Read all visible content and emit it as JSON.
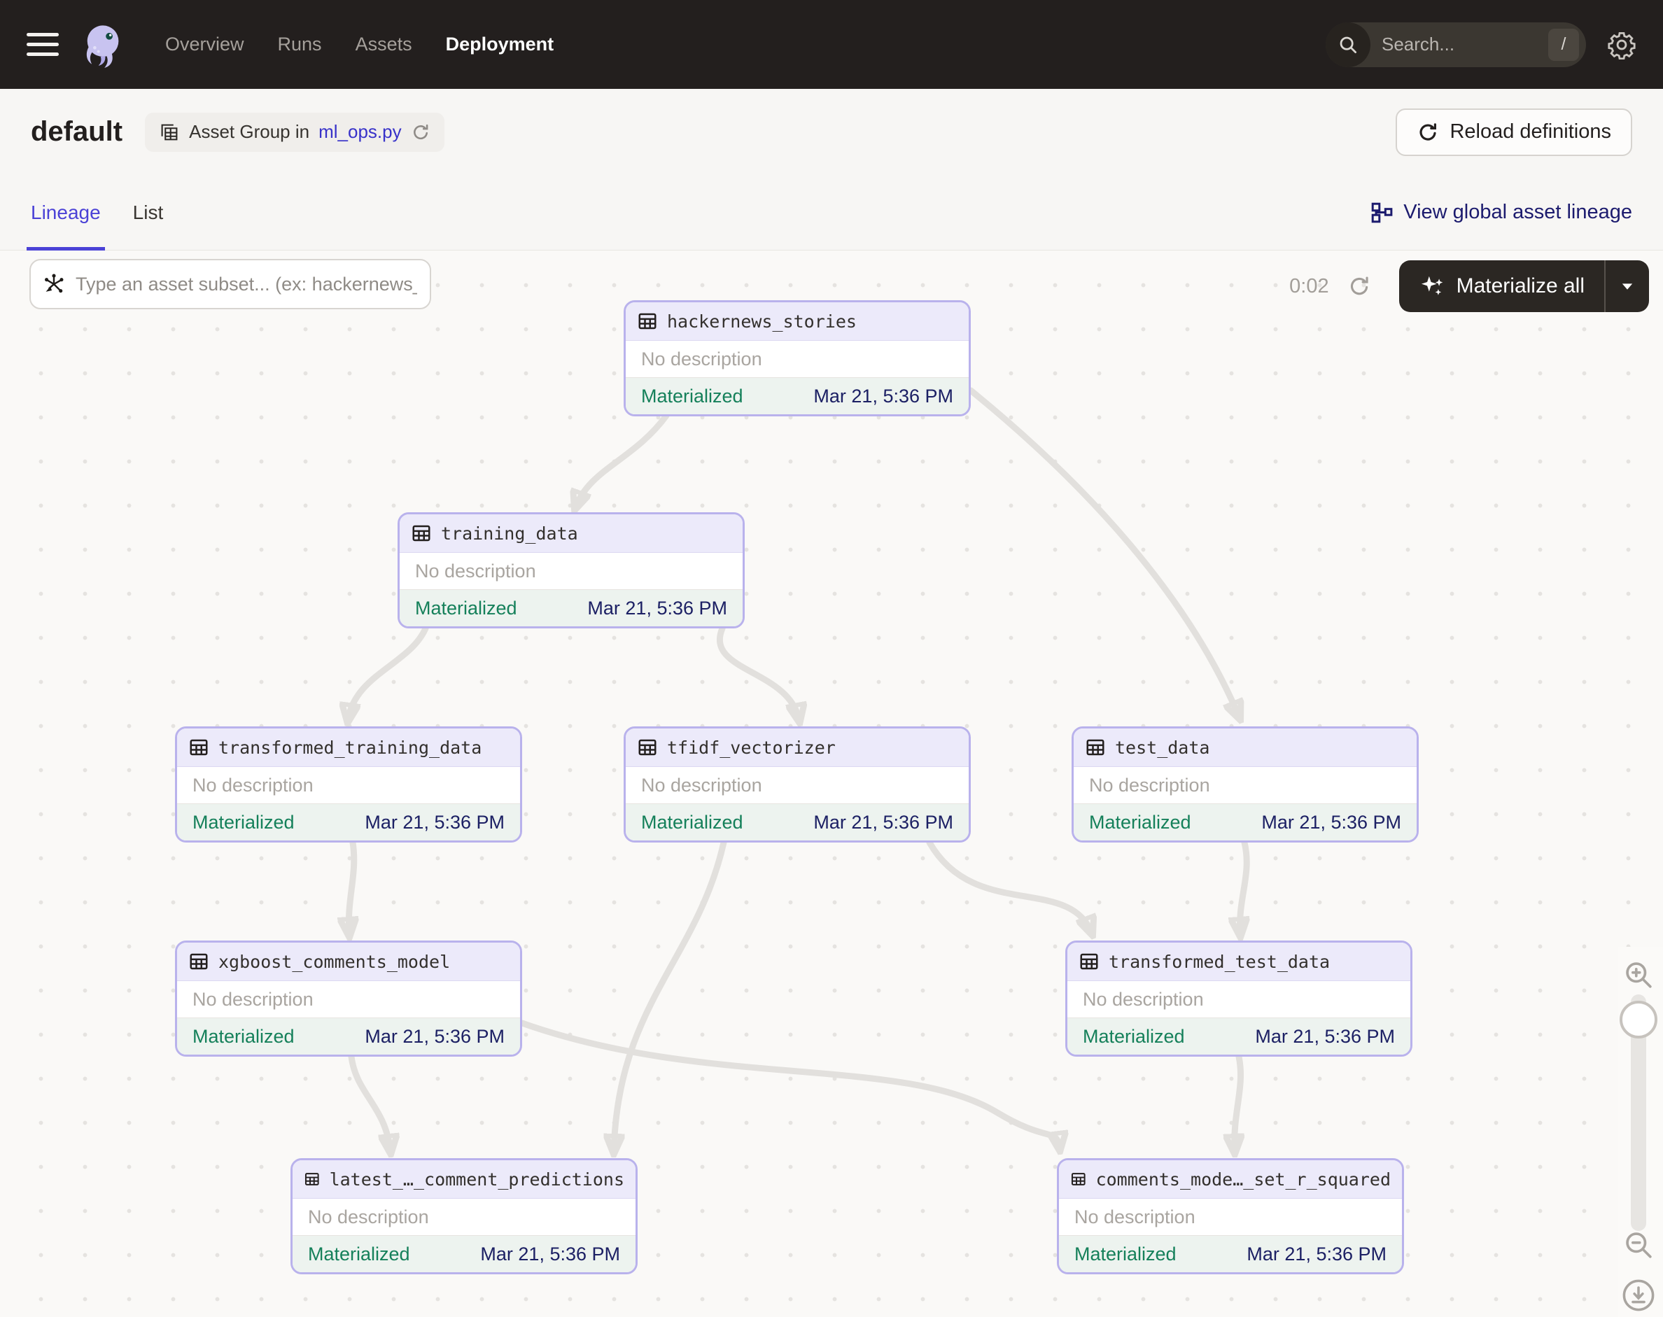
{
  "topbar": {
    "nav": [
      {
        "label": "Overview",
        "active": false
      },
      {
        "label": "Runs",
        "active": false
      },
      {
        "label": "Assets",
        "active": false
      },
      {
        "label": "Deployment",
        "active": true
      }
    ],
    "search": {
      "placeholder": "Search...",
      "shortcut": "/"
    }
  },
  "header": {
    "title": "default",
    "badge_label": "Asset Group in",
    "badge_link": "ml_ops.py",
    "reload_button": "Reload definitions"
  },
  "tabs": [
    {
      "label": "Lineage",
      "active": true
    },
    {
      "label": "List",
      "active": false
    }
  ],
  "global_lineage_link": "View global asset lineage",
  "graph_toolbar": {
    "filter_placeholder": "Type an asset subset... (ex: hackernews_stories++)",
    "timer": "0:02",
    "materialize_label": "Materialize all"
  },
  "graph": {
    "nodes": [
      {
        "id": "hackernews_stories",
        "name": "hackernews_stories",
        "description": "No description",
        "status": "Materialized",
        "timestamp": "Mar 21, 5:36 PM"
      },
      {
        "id": "training_data",
        "name": "training_data",
        "description": "No description",
        "status": "Materialized",
        "timestamp": "Mar 21, 5:36 PM"
      },
      {
        "id": "transformed_training_data",
        "name": "transformed_training_data",
        "description": "No description",
        "status": "Materialized",
        "timestamp": "Mar 21, 5:36 PM"
      },
      {
        "id": "tfidf_vectorizer",
        "name": "tfidf_vectorizer",
        "description": "No description",
        "status": "Materialized",
        "timestamp": "Mar 21, 5:36 PM"
      },
      {
        "id": "test_data",
        "name": "test_data",
        "description": "No description",
        "status": "Materialized",
        "timestamp": "Mar 21, 5:36 PM"
      },
      {
        "id": "xgboost_comments_model",
        "name": "xgboost_comments_model",
        "description": "No description",
        "status": "Materialized",
        "timestamp": "Mar 21, 5:36 PM"
      },
      {
        "id": "transformed_test_data",
        "name": "transformed_test_data",
        "description": "No description",
        "status": "Materialized",
        "timestamp": "Mar 21, 5:36 PM"
      },
      {
        "id": "latest_comment_predictions",
        "name": "latest_…_comment_predictions",
        "description": "No description",
        "status": "Materialized",
        "timestamp": "Mar 21, 5:36 PM"
      },
      {
        "id": "comments_model_r_squared",
        "name": "comments_mode…_set_r_squared",
        "description": "No description",
        "status": "Materialized",
        "timestamp": "Mar 21, 5:36 PM"
      }
    ],
    "edges": [
      {
        "from": "hackernews_stories",
        "to": "training_data"
      },
      {
        "from": "hackernews_stories",
        "to": "test_data"
      },
      {
        "from": "training_data",
        "to": "transformed_training_data"
      },
      {
        "from": "training_data",
        "to": "tfidf_vectorizer"
      },
      {
        "from": "transformed_training_data",
        "to": "xgboost_comments_model"
      },
      {
        "from": "tfidf_vectorizer",
        "to": "transformed_test_data"
      },
      {
        "from": "tfidf_vectorizer",
        "to": "latest_comment_predictions"
      },
      {
        "from": "test_data",
        "to": "transformed_test_data"
      },
      {
        "from": "xgboost_comments_model",
        "to": "latest_comment_predictions"
      },
      {
        "from": "xgboost_comments_model",
        "to": "comments_model_r_squared"
      },
      {
        "from": "transformed_test_data",
        "to": "comments_model_r_squared"
      }
    ]
  },
  "colors": {
    "topbar_bg": "#231F1E",
    "accent_indigo": "#4B42D6",
    "node_border": "#B9B2EC",
    "node_header_bg": "#ECEAFA",
    "node_footer_bg": "#EDF3EF",
    "materialized_green": "#15805A",
    "timestamp_navy": "#1C2064",
    "edge_gray": "#E2E0DD",
    "link_blue": "#3832C9"
  }
}
